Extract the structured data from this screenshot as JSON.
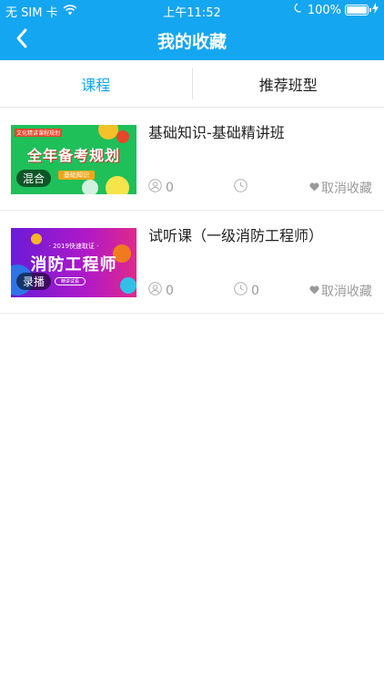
{
  "status_bar": {
    "carrier": "无 SIM 卡",
    "time": "上午11:52",
    "battery_level": "100%",
    "battery_fraction": 1.0
  },
  "nav": {
    "title": "我的收藏",
    "back_icon": "chevron-left-icon"
  },
  "tabs": [
    {
      "label": "课程",
      "active": true
    },
    {
      "label": "推荐班型",
      "active": false
    }
  ],
  "colors": {
    "brand": "#14a6f0",
    "muted": "#9a9a9a"
  },
  "courses": [
    {
      "title": "基础知识-基础精讲班",
      "badge": "混合",
      "thumb_headline": "全年备考规划",
      "thumb_banner": "文化精讲课程规划",
      "thumb_tag": "基础知识",
      "students": "0",
      "duration": "",
      "unfavorite_label": "取消收藏"
    },
    {
      "title": "试听课（一级消防工程师）",
      "badge": "录播",
      "thumb_sub": "· 2019快速取证 ·",
      "thumb_headline": "消防工程师",
      "thumb_tag": "精讲试看",
      "students": "0",
      "duration": "0",
      "unfavorite_label": "取消收藏"
    }
  ]
}
